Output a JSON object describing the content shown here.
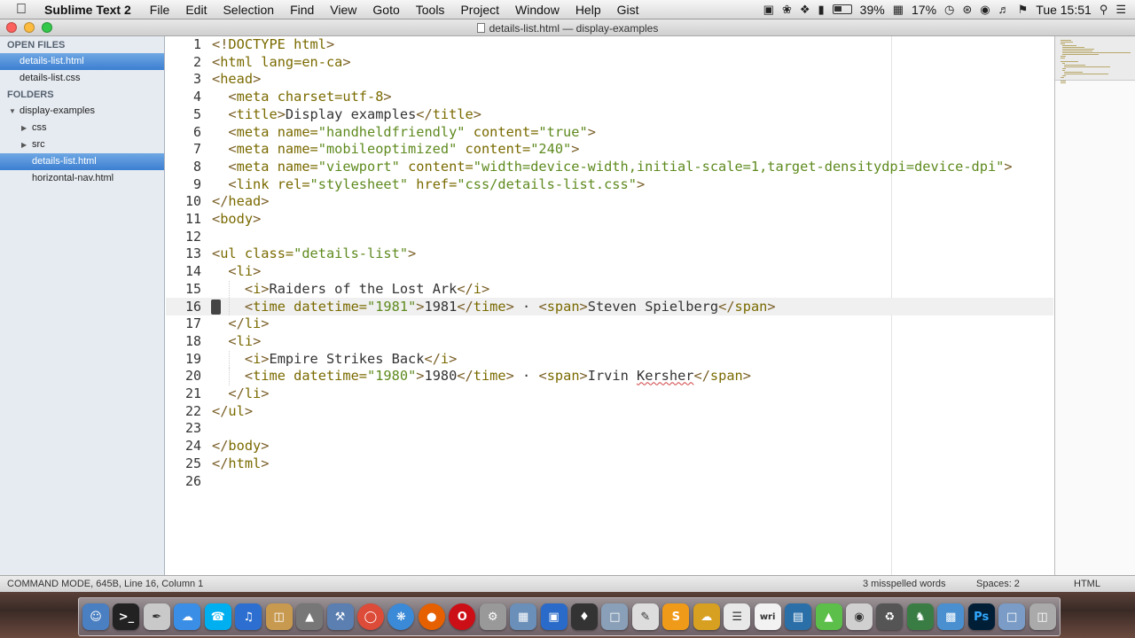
{
  "menubar": {
    "app_name": "Sublime Text 2",
    "menus": [
      "File",
      "Edit",
      "Selection",
      "Find",
      "View",
      "Goto",
      "Tools",
      "Project",
      "Window",
      "Help",
      "Gist"
    ],
    "battery_percent": "39%",
    "cpu_percent": "17%",
    "clock": "Tue 15:51"
  },
  "window": {
    "title": "details-list.html — display-examples"
  },
  "sidebar": {
    "open_files_header": "OPEN FILES",
    "open_files": [
      "details-list.html",
      "details-list.css"
    ],
    "folders_header": "FOLDERS",
    "root_folder": "display-examples",
    "subfolders": [
      "css",
      "src"
    ],
    "files": [
      "details-list.html",
      "horizontal-nav.html"
    ],
    "selected_open_file": "details-list.html",
    "selected_file": "details-list.html"
  },
  "editor": {
    "current_line": 16,
    "lines": [
      "<!DOCTYPE html>",
      "<html lang=en-ca>",
      "<head>",
      "  <meta charset=utf-8>",
      "  <title>Display examples</title>",
      "  <meta name=\"handheldfriendly\" content=\"true\">",
      "  <meta name=\"mobileoptimized\" content=\"240\">",
      "  <meta name=\"viewport\" content=\"width=device-width,initial-scale=1,target-densitydpi=device-dpi\">",
      "  <link rel=\"stylesheet\" href=\"css/details-list.css\">",
      "</head>",
      "<body>",
      "",
      "<ul class=\"details-list\">",
      "  <li>",
      "    <i>Raiders of the Lost Ark</i>",
      "    <time datetime=\"1981\">1981</time> · <span>Steven Spielberg</span>",
      "  </li>",
      "  <li>",
      "    <i>Empire Strikes Back</i>",
      "    <time datetime=\"1980\">1980</time> · <span>Irvin Kersher</span>",
      "  </li>",
      "</ul>",
      "",
      "</body>",
      "</html>",
      ""
    ]
  },
  "statusbar": {
    "left": "COMMAND MODE, 645B, Line 16, Column 1",
    "spelling": "3 misspelled words",
    "indent": "Spaces: 2",
    "syntax": "HTML"
  },
  "dock": {
    "labels": [
      "S",
      "wri",
      "Ps"
    ]
  },
  "colors": {
    "tag": "#795e26",
    "string": "#5e8a1e",
    "selection": "#3c7fd1",
    "sidebar_bg": "#e6ebf1"
  }
}
